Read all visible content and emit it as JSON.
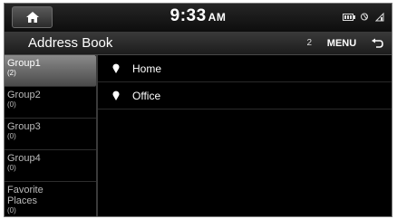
{
  "status": {
    "time": "9:33",
    "ampm": "AM"
  },
  "header": {
    "title": "Address Book",
    "count": "2",
    "menu_label": "MENU"
  },
  "groups": [
    {
      "name": "Group1",
      "count": "(2)",
      "active": true
    },
    {
      "name": "Group2",
      "count": "(0)"
    },
    {
      "name": "Group3",
      "count": "(0)"
    },
    {
      "name": "Group4",
      "count": "(0)"
    },
    {
      "name": "Favorite Places",
      "count": "(0)"
    }
  ],
  "entries": [
    {
      "label": "Home",
      "icon": "map-pin-icon"
    },
    {
      "label": "Office",
      "icon": "map-pin-icon"
    }
  ],
  "icons": [
    "home-icon",
    "battery-icon",
    "bluetooth-icon",
    "signal-icon",
    "back-arrow-icon"
  ]
}
